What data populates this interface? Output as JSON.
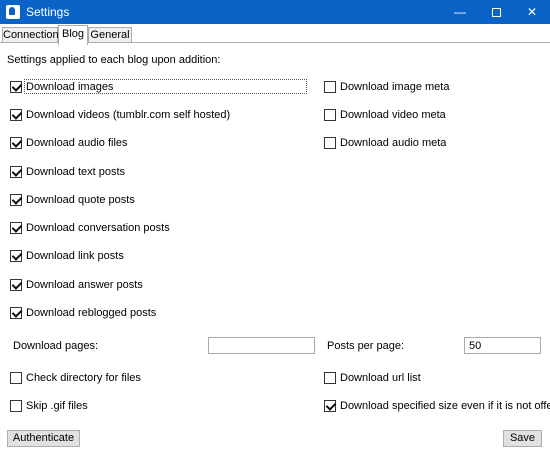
{
  "window": {
    "title": "Settings",
    "minimize_glyph": "—",
    "close_glyph": "✕"
  },
  "tabs": [
    {
      "label": "Connection",
      "selected": false
    },
    {
      "label": "Blog",
      "selected": true
    },
    {
      "label": "General",
      "selected": false
    }
  ],
  "blog": {
    "heading": "Settings applied to each blog upon addition:",
    "checkboxes": [
      {
        "label": "Download images",
        "checked": true
      },
      {
        "label": "Download videos (tumblr.com self hosted)",
        "checked": true
      },
      {
        "label": "Download audio files",
        "checked": true
      },
      {
        "label": "Download text posts",
        "checked": true
      },
      {
        "label": "Download quote posts",
        "checked": true
      },
      {
        "label": "Download conversation posts",
        "checked": true
      },
      {
        "label": "Download link posts",
        "checked": true
      },
      {
        "label": "Download answer posts",
        "checked": true
      },
      {
        "label": "Download reblogged posts",
        "checked": true
      },
      {
        "label": "Download image meta",
        "checked": false
      },
      {
        "label": "Download video meta",
        "checked": false
      },
      {
        "label": "Download audio meta",
        "checked": false
      },
      {
        "label": "Check directory for files",
        "checked": false
      },
      {
        "label": "Download url list",
        "checked": false
      },
      {
        "label": "Skip .gif files",
        "checked": false
      },
      {
        "label": "Download specified size even if it is not offered",
        "checked": true
      }
    ],
    "download_pages_label": "Download pages:",
    "download_pages_value": "",
    "posts_per_page_label": "Posts per page:",
    "posts_per_page_value": "50"
  },
  "buttons": {
    "authenticate": "Authenticate",
    "save": "Save"
  },
  "icons": {
    "app": "app-icon",
    "minimize": "minimize-icon",
    "maximize": "maximize-icon",
    "close": "close-icon",
    "check": "checkmark-icon"
  },
  "colors": {
    "titlebar": "#0a64c8",
    "button_bg": "#e1e1e1"
  }
}
